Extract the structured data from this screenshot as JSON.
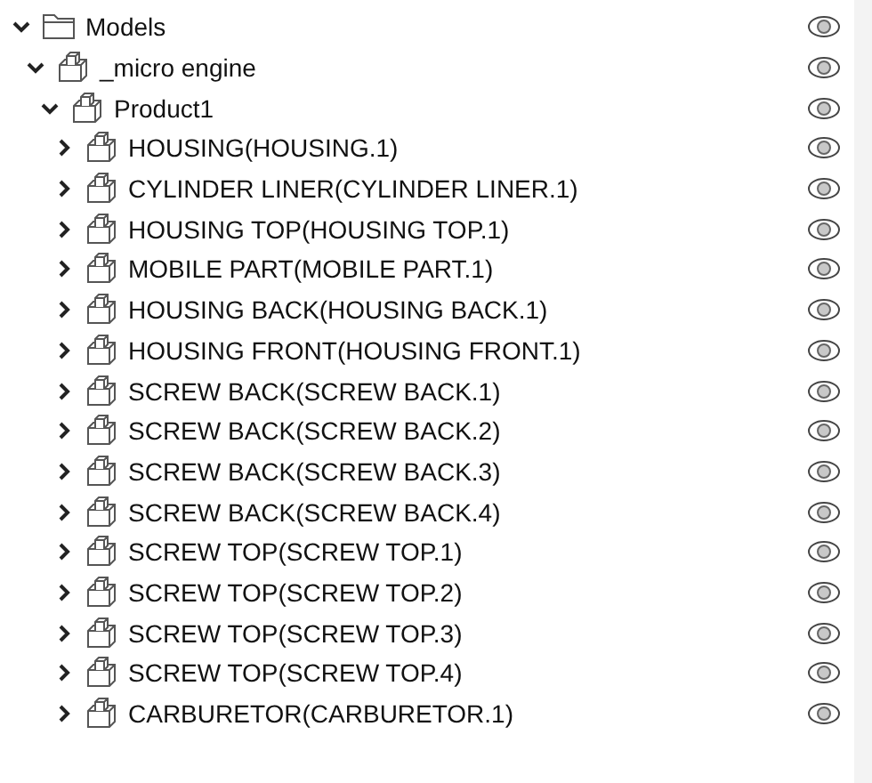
{
  "tree": [
    {
      "kind": "folder",
      "label": "Models",
      "expanded": true,
      "visible": true,
      "children": [
        {
          "kind": "part",
          "label": "_micro engine",
          "expanded": true,
          "visible": true,
          "children": [
            {
              "kind": "part",
              "label": "Product1",
              "expanded": true,
              "visible": true,
              "children": [
                {
                  "kind": "part",
                  "label": "HOUSING(HOUSING.1)",
                  "expanded": false,
                  "visible": true
                },
                {
                  "kind": "part",
                  "label": "CYLINDER LINER(CYLINDER LINER.1)",
                  "expanded": false,
                  "visible": true
                },
                {
                  "kind": "part",
                  "label": "HOUSING TOP(HOUSING TOP.1)",
                  "expanded": false,
                  "visible": true
                },
                {
                  "kind": "part",
                  "label": "MOBILE PART(MOBILE PART.1)",
                  "expanded": false,
                  "visible": true
                },
                {
                  "kind": "part",
                  "label": "HOUSING BACK(HOUSING BACK.1)",
                  "expanded": false,
                  "visible": true
                },
                {
                  "kind": "part",
                  "label": "HOUSING FRONT(HOUSING FRONT.1)",
                  "expanded": false,
                  "visible": true
                },
                {
                  "kind": "part",
                  "label": "SCREW BACK(SCREW BACK.1)",
                  "expanded": false,
                  "visible": true
                },
                {
                  "kind": "part",
                  "label": "SCREW BACK(SCREW BACK.2)",
                  "expanded": false,
                  "visible": true
                },
                {
                  "kind": "part",
                  "label": "SCREW BACK(SCREW BACK.3)",
                  "expanded": false,
                  "visible": true
                },
                {
                  "kind": "part",
                  "label": "SCREW BACK(SCREW BACK.4)",
                  "expanded": false,
                  "visible": true
                },
                {
                  "kind": "part",
                  "label": "SCREW TOP(SCREW TOP.1)",
                  "expanded": false,
                  "visible": true
                },
                {
                  "kind": "part",
                  "label": "SCREW TOP(SCREW TOP.2)",
                  "expanded": false,
                  "visible": true
                },
                {
                  "kind": "part",
                  "label": "SCREW TOP(SCREW TOP.3)",
                  "expanded": false,
                  "visible": true
                },
                {
                  "kind": "part",
                  "label": "SCREW TOP(SCREW TOP.4)",
                  "expanded": false,
                  "visible": true
                },
                {
                  "kind": "part",
                  "label": "CARBURETOR(CARBURETOR.1)",
                  "expanded": false,
                  "visible": true
                }
              ]
            }
          ]
        }
      ]
    }
  ]
}
